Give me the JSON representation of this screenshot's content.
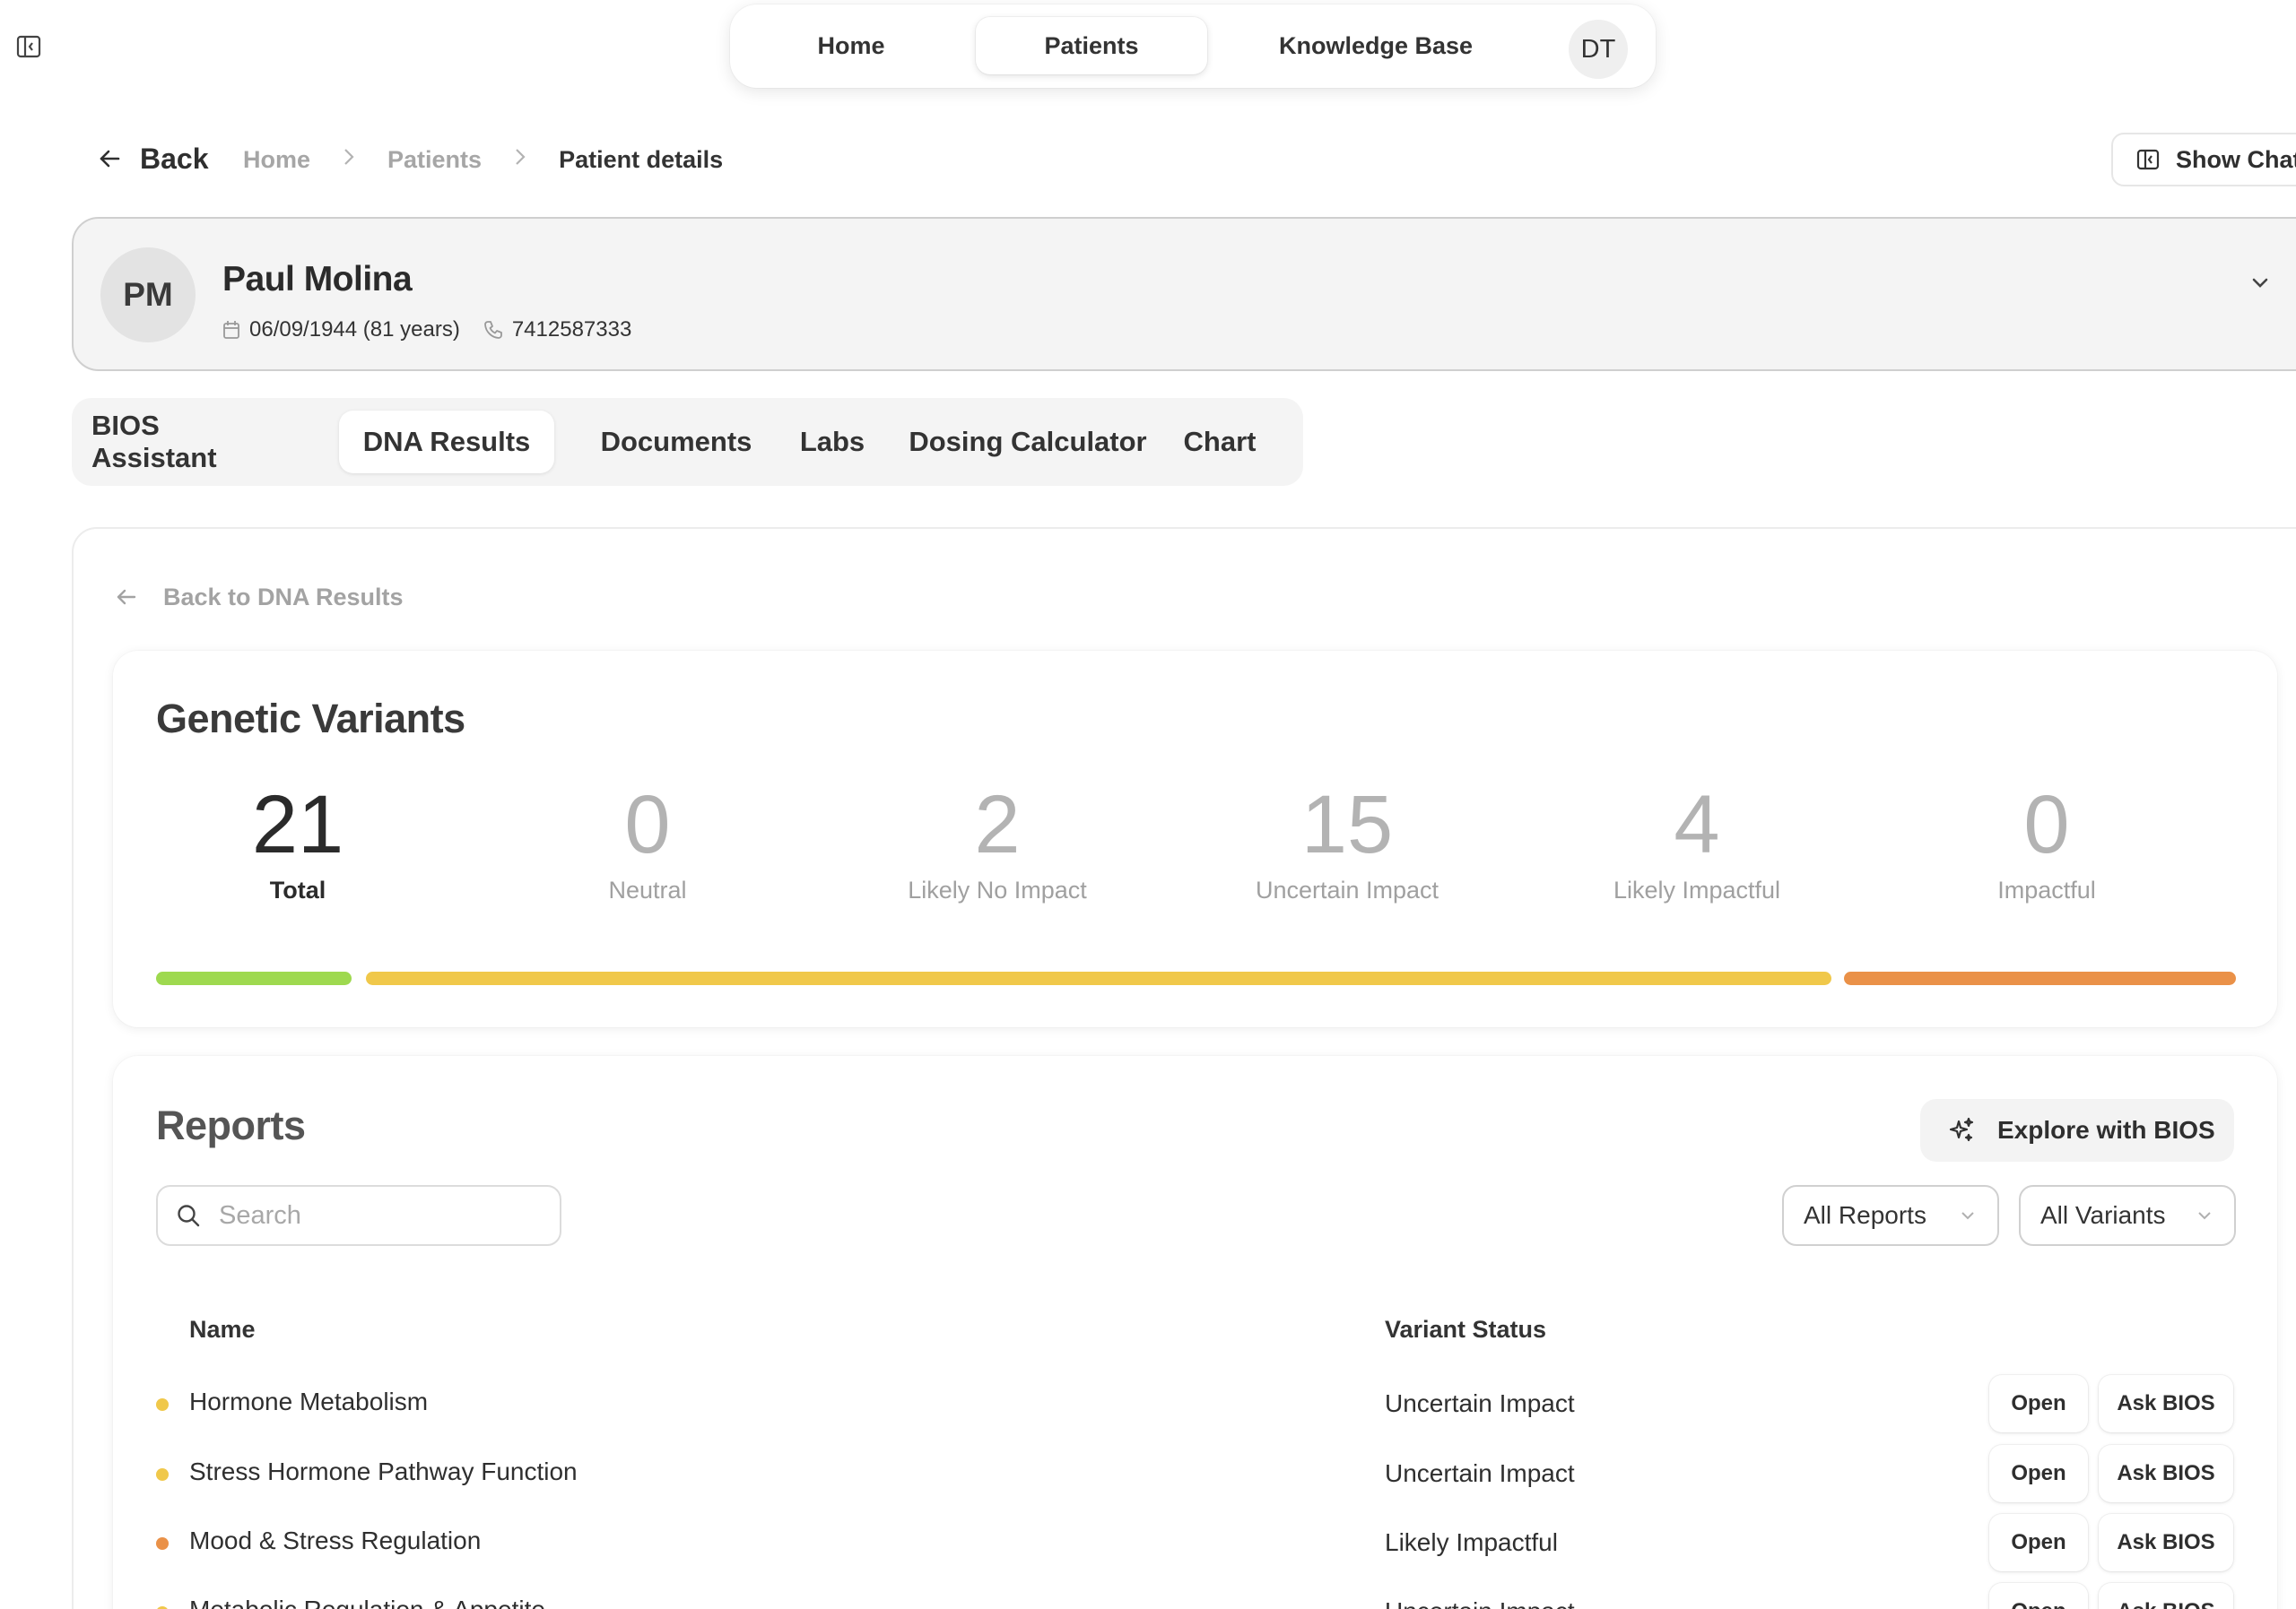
{
  "nav": {
    "items": [
      "Home",
      "Patients",
      "Knowledge Base"
    ],
    "user_initials": "DT",
    "active": "Patients"
  },
  "breadcrumb": {
    "back_label": "Back",
    "items": [
      "Home",
      "Patients"
    ],
    "current": "Patient details"
  },
  "show_chat_label": "Show Chat",
  "patient": {
    "initials": "PM",
    "name": "Paul Molina",
    "dob": "06/09/1944 (81 years)",
    "phone": "7412587333"
  },
  "tabs": {
    "items": [
      "BIOS Assistant",
      "DNA Results",
      "Documents",
      "Labs",
      "Dosing Calculator",
      "Chart"
    ],
    "active": "DNA Results"
  },
  "back_to_dna_label": "Back to DNA Results",
  "variants": {
    "title": "Genetic Variants",
    "stats": [
      {
        "value": "21",
        "label": "Total"
      },
      {
        "value": "0",
        "label": "Neutral"
      },
      {
        "value": "2",
        "label": "Likely No Impact"
      },
      {
        "value": "15",
        "label": "Uncertain Impact"
      },
      {
        "value": "4",
        "label": "Likely Impactful"
      },
      {
        "value": "0",
        "label": "Impactful"
      }
    ],
    "colors": {
      "likely_no_impact": "#9ed94f",
      "uncertain_impact": "#f0c84a",
      "likely_impactful": "#ea9148"
    }
  },
  "reports": {
    "title": "Reports",
    "explore_label": "Explore with BIOS",
    "search_placeholder": "Search",
    "filter_reports": "All Reports",
    "filter_variants": "All Variants",
    "columns": {
      "name": "Name",
      "status": "Variant Status"
    },
    "open_label": "Open",
    "ask_label": "Ask BIOS",
    "rows": [
      {
        "name": "Hormone Metabolism",
        "status": "Uncertain Impact",
        "dot_color": "#f0c84a"
      },
      {
        "name": "Stress Hormone Pathway Function",
        "status": "Uncertain Impact",
        "dot_color": "#f0c84a"
      },
      {
        "name": "Mood & Stress Regulation",
        "status": "Likely Impactful",
        "dot_color": "#ea9148"
      },
      {
        "name": "Metabolic Regulation & Appetite",
        "status": "Uncertain Impact",
        "dot_color": "#f0c84a"
      }
    ]
  }
}
